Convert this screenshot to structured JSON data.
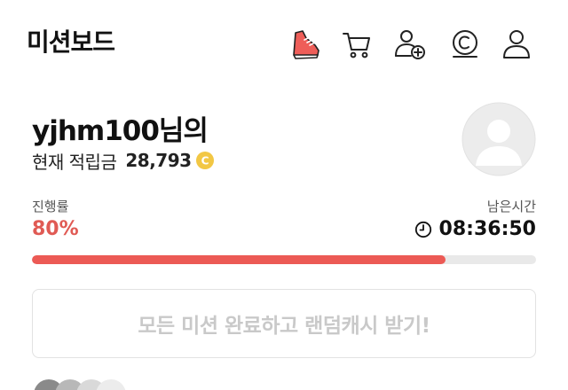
{
  "header": {
    "title": "미션보드",
    "icons": [
      "running-shoe-icon",
      "cart-icon",
      "add-user-icon",
      "cash-icon",
      "profile-icon"
    ]
  },
  "user": {
    "name": "yjhm100님의",
    "points_label": "현재 적립금",
    "points_value": "28,793",
    "coin_letter": "C"
  },
  "progress": {
    "label": "진행률",
    "value_text": "80%",
    "fraction": 0.82
  },
  "time": {
    "label": "남은시간",
    "value": "08:36:50"
  },
  "reward_button": {
    "label": "모든 미션 완료하고 랜덤캐시 받기!"
  },
  "colors": {
    "accent": "#ec5a55",
    "accent_text": "#e05a54",
    "coin": "#f2c744",
    "disabled_text": "#c9c9c9"
  }
}
